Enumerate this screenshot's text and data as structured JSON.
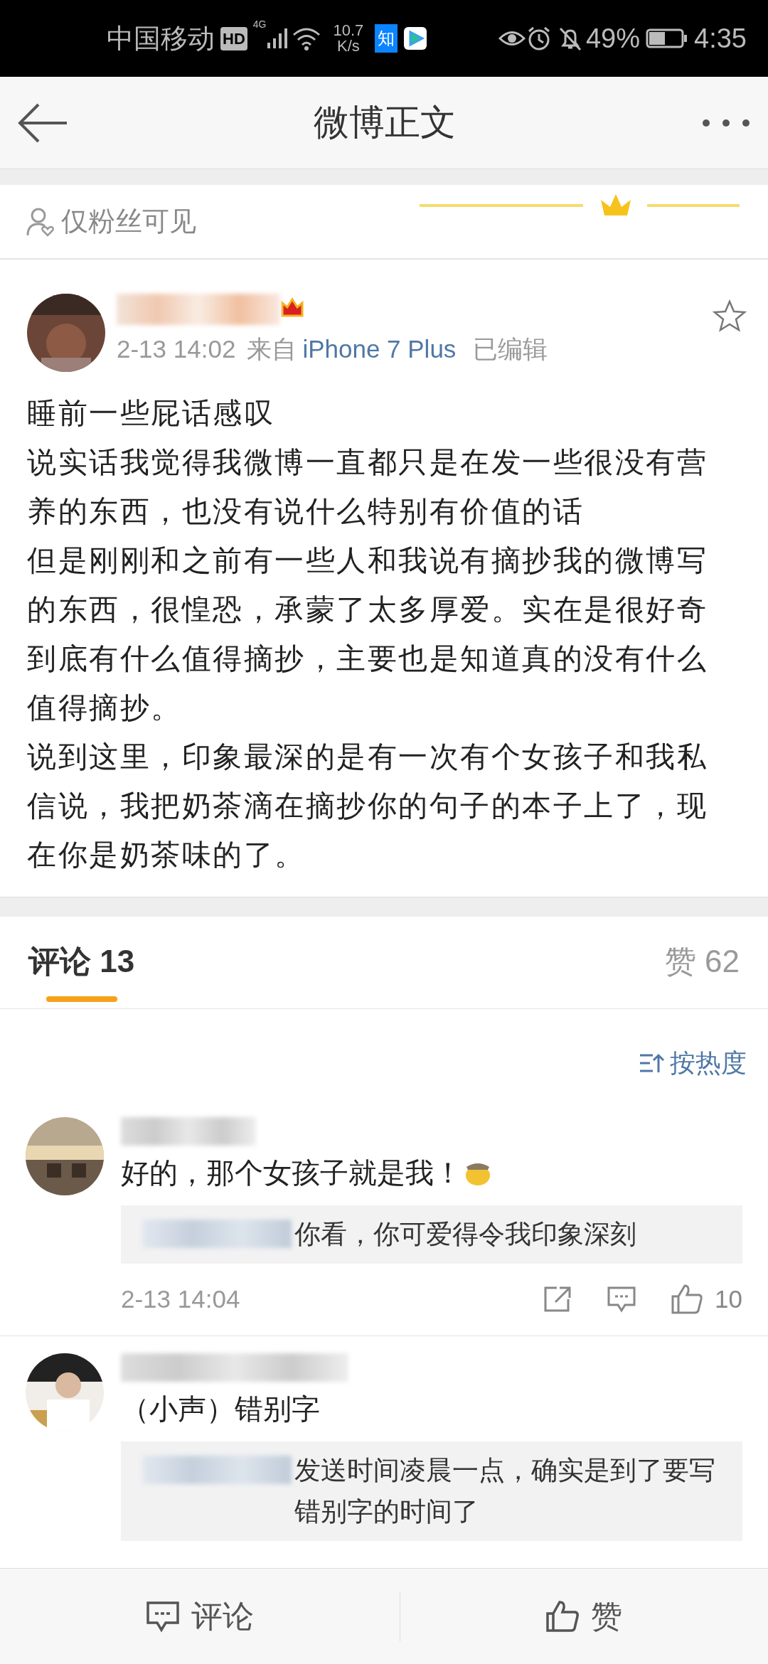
{
  "status_bar": {
    "carrier": "中国移动",
    "hd_badge": "HD",
    "network": "4G",
    "speed_value": "10.7",
    "speed_unit": "K/s",
    "app_badge": "知",
    "battery": "49%",
    "time": "4:35"
  },
  "header": {
    "title": "微博正文"
  },
  "visibility": {
    "label": "仅粉丝可见"
  },
  "post": {
    "time": "2-13 14:02",
    "source_prefix": "来自",
    "source": "iPhone 7 Plus",
    "edited": "已编辑",
    "paragraphs": [
      "睡前一些屁话感叹",
      "说实话我觉得我微博一直都只是在发一些很没有营养的东西，也没有说什么特别有价值的话",
      "但是刚刚和之前有一些人和我说有摘抄我的微博写的东西，很惶恐，承蒙了太多厚爱。实在是很好奇到底有什么值得摘抄，主要也是知道真的没有什么值得摘抄。",
      "说到这里，印象最深的是有一次有个女孩子和我私信说，我把奶茶滴在摘抄你的句子的本子上了，现在你是奶茶味的了。"
    ]
  },
  "comment_tabs": [
    {
      "label": "评论 13",
      "selected": true
    },
    {
      "label": "赞 62",
      "selected": false
    }
  ],
  "sort": {
    "label": "按热度"
  },
  "comments": [
    {
      "text": "好的，那个女孩子就是我！",
      "reply": "你看，你可爱得令我印象深刻",
      "time": "2-13 14:04",
      "likes": "10"
    },
    {
      "text": "（小声）错别字",
      "reply": "发送时间凌晨一点，确实是到了要写错别字的时间了"
    }
  ],
  "bottom_bar": {
    "comment": "评论",
    "like": "赞"
  }
}
